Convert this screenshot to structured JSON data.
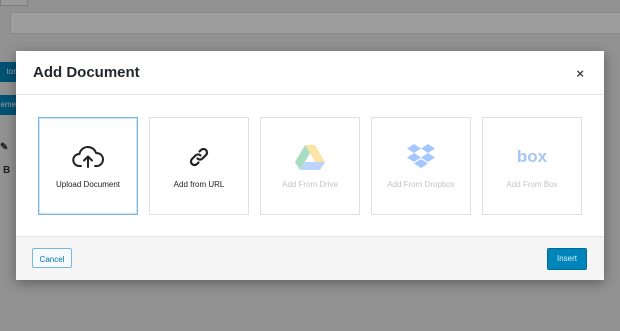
{
  "modal": {
    "title": "Add Document",
    "close_glyph": "×",
    "options": [
      {
        "label": "Upload Document",
        "icon": "cloud-upload-icon",
        "selected": true,
        "disabled": false
      },
      {
        "label": "Add from URL",
        "icon": "link-icon",
        "selected": false,
        "disabled": false
      },
      {
        "label": "Add From Drive",
        "icon": "google-drive-icon",
        "selected": false,
        "disabled": true
      },
      {
        "label": "Add From Dropbox",
        "icon": "dropbox-icon",
        "selected": false,
        "disabled": true
      },
      {
        "label": "Add From Box",
        "icon": "box-icon",
        "selected": false,
        "disabled": true
      }
    ],
    "box_logo_text": "box",
    "cancel_label": "Cancel",
    "insert_label": "Insert"
  },
  "background": {
    "pill_1": "tor",
    "pill_2": "eme",
    "tool_bold": "B"
  },
  "colors": {
    "accent": "#0085ba",
    "overlay": "rgba(0,0,0,0.38)",
    "selected_border": "#7ab6e0"
  }
}
